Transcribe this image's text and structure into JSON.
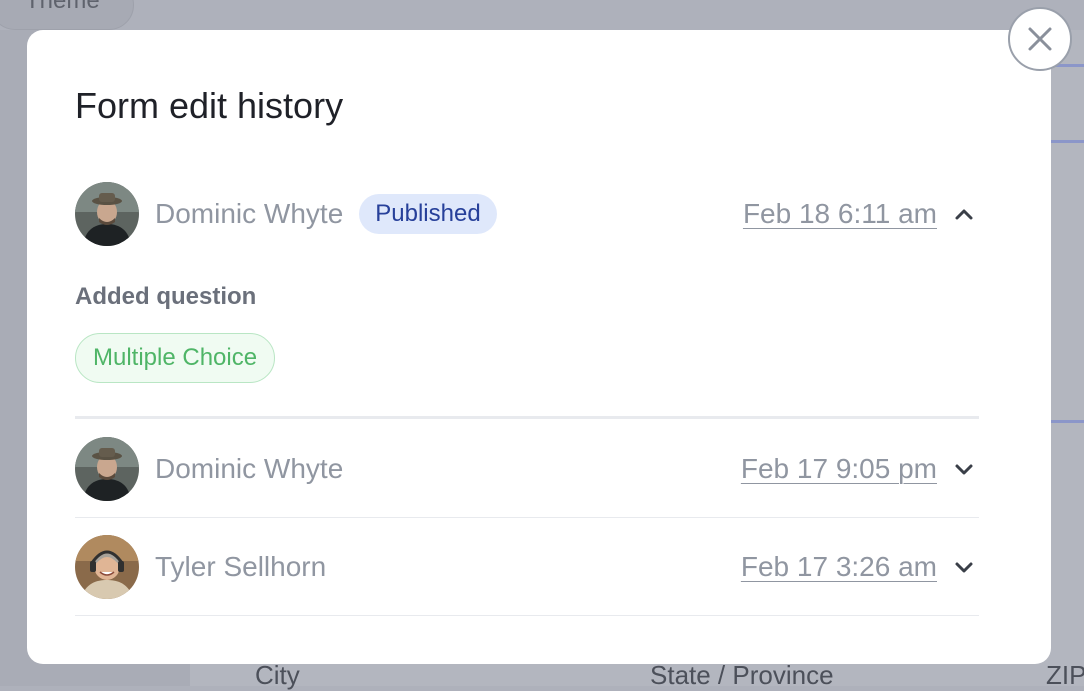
{
  "background": {
    "chip_label": "Theme",
    "footer_columns": [
      "City",
      "State / Province",
      "ZIP"
    ]
  },
  "modal": {
    "title": "Form edit history",
    "close_icon": "close-icon",
    "entries": [
      {
        "author": "Dominic Whyte",
        "badge": "Published",
        "timestamp": "Feb 18 6:11 am",
        "expanded": true,
        "changes": {
          "label": "Added question",
          "question_type": "Multiple Choice"
        }
      },
      {
        "author": "Dominic Whyte",
        "timestamp": "Feb 17 9:05 pm",
        "expanded": false
      },
      {
        "author": "Tyler Sellhorn",
        "timestamp": "Feb 17 3:26 am",
        "expanded": false
      }
    ]
  },
  "colors": {
    "badge_bg": "#dfe8fb",
    "badge_text": "#27409a",
    "question_chip_text": "#4fb567",
    "question_chip_border": "#b9e6c4",
    "muted_text": "#9096a1"
  }
}
